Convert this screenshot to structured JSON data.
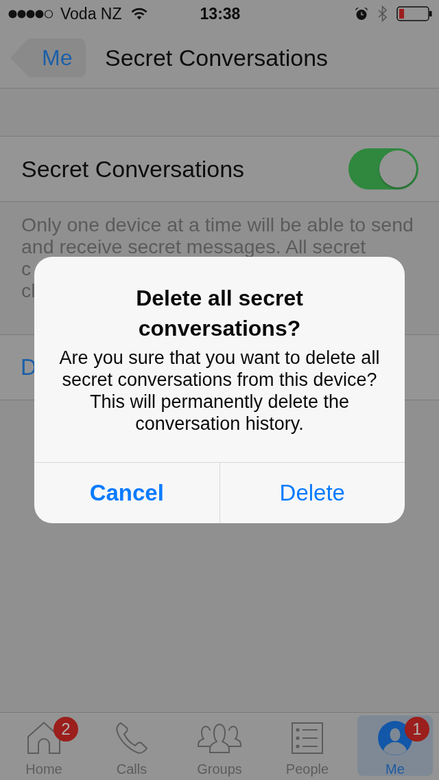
{
  "status_bar": {
    "carrier": "Voda NZ",
    "time": "13:38"
  },
  "nav_bar": {
    "back_label": "Me",
    "title": "Secret Conversations"
  },
  "settings": {
    "toggle_row": {
      "label": "Secret Conversations",
      "on": true
    },
    "footnote_lines": [
      "Only one device at a time will be able to send",
      "and receive secret messages. All secret",
      "c",
      "cl"
    ],
    "action_row": {
      "label": "D"
    }
  },
  "dialog": {
    "title": "Delete all secret conversations?",
    "message": "Are you sure that you want to delete all secret conversations from this device? This will permanently delete the conversation history.",
    "buttons": [
      {
        "label": "Cancel",
        "kind": "preferred"
      },
      {
        "label": "Delete",
        "kind": "default"
      }
    ]
  },
  "tab_bar": [
    {
      "label": "Home",
      "badge": "2",
      "selected": false
    },
    {
      "label": "Calls",
      "selected": false
    },
    {
      "label": "Groups",
      "selected": false
    },
    {
      "label": "People",
      "selected": false
    },
    {
      "label": "Me",
      "badge": "1",
      "selected": true
    }
  ]
}
